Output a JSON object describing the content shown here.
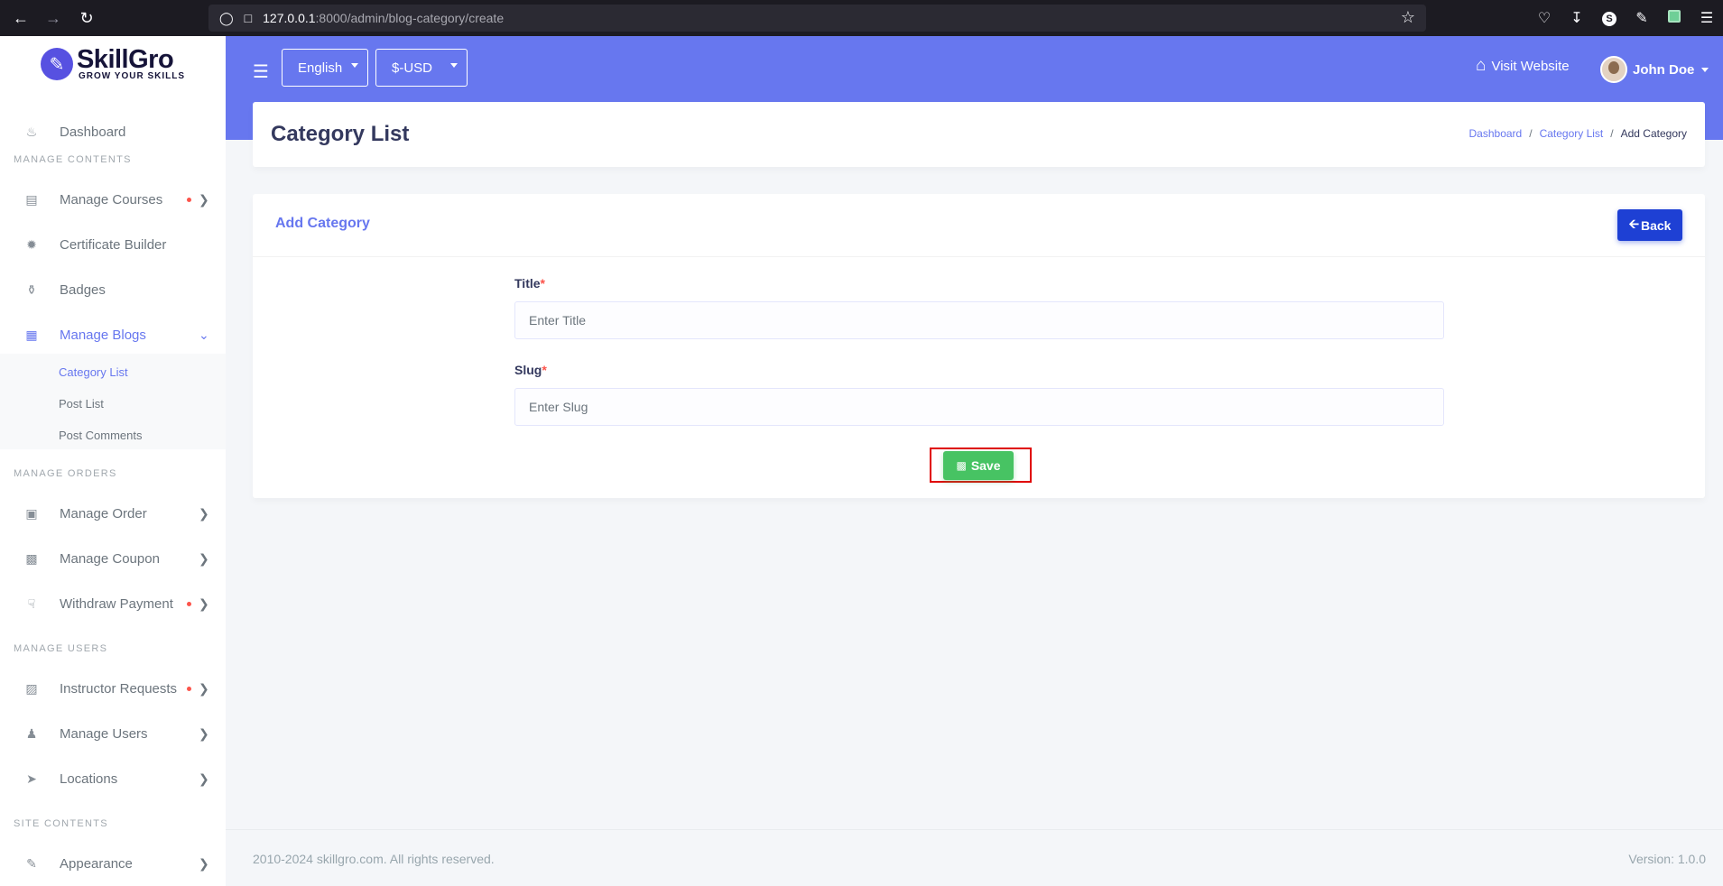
{
  "browser": {
    "url_host": "127.0.0.1",
    "url_path": ":8000/admin/blog-category/create"
  },
  "brand": {
    "name": "SkillGro",
    "tagline": "GROW YOUR SKILLS"
  },
  "sidebar": {
    "dashboard": "Dashboard",
    "headers": {
      "contents": "MANAGE CONTENTS",
      "orders": "MANAGE ORDERS",
      "users": "MANAGE USERS",
      "site": "SITE CONTENTS"
    },
    "items": {
      "manage_courses": "Manage Courses",
      "certificate_builder": "Certificate Builder",
      "badges": "Badges",
      "manage_blogs": "Manage Blogs",
      "manage_order": "Manage Order",
      "manage_coupon": "Manage Coupon",
      "withdraw_payment": "Withdraw Payment",
      "instructor_requests": "Instructor Requests",
      "manage_users": "Manage Users",
      "locations": "Locations",
      "appearance": "Appearance"
    },
    "blog_submenu": {
      "category_list": "Category List",
      "post_list": "Post List",
      "post_comments": "Post Comments"
    }
  },
  "topbar": {
    "language": "English",
    "currency": "$-USD",
    "visit_website": "Visit Website",
    "user_name": "John Doe"
  },
  "page": {
    "title": "Category List",
    "breadcrumb": {
      "dashboard": "Dashboard",
      "category_list": "Category List",
      "current": "Add Category"
    }
  },
  "form": {
    "card_title": "Add Category",
    "back_label": "Back",
    "title_label": "Title",
    "title_placeholder": "Enter Title",
    "slug_label": "Slug",
    "slug_placeholder": "Enter Slug",
    "required_mark": "*",
    "save_label": "Save"
  },
  "footer": {
    "copyright": "2010-2024 skillgro.com. All rights reserved.",
    "version": "Version: 1.0.0"
  },
  "colors": {
    "primary": "#6777ef",
    "back_button": "#1e40d4",
    "save_button": "#47c363",
    "notification_dot": "#fc544b",
    "highlight": "#e00000"
  }
}
